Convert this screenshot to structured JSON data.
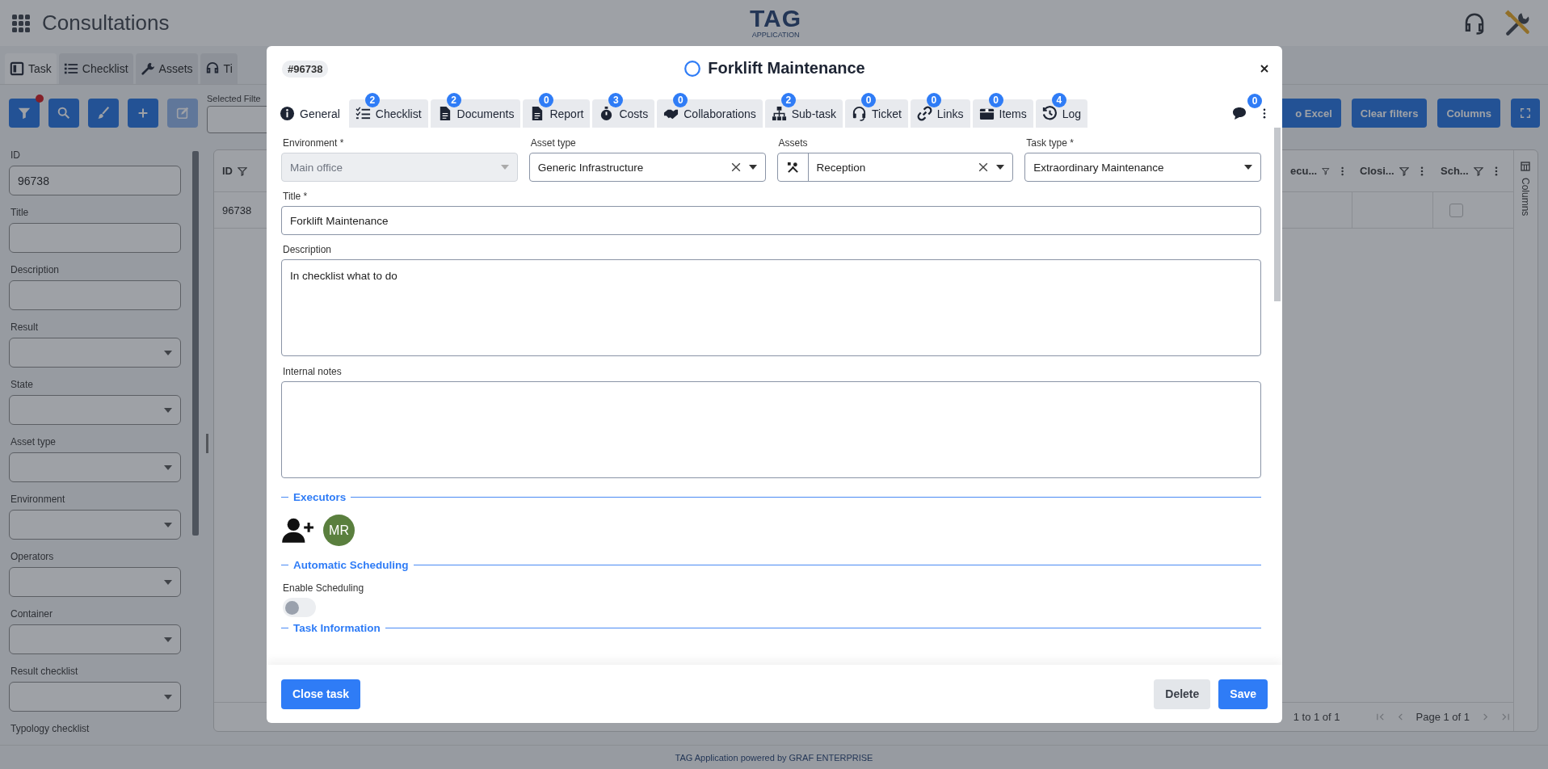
{
  "app": {
    "title": "Consultations",
    "logo": {
      "text": "TAG",
      "subtext": "APPLICATION"
    }
  },
  "page_tabs": [
    {
      "label": "Task",
      "selected": true
    },
    {
      "label": "Checklist",
      "selected": false
    },
    {
      "label": "Assets",
      "selected": false
    },
    {
      "label": "Ti",
      "selected": false
    }
  ],
  "toolbar": {
    "buttons": [
      {
        "kind": "filter",
        "disabled": false,
        "indicator": true
      },
      {
        "kind": "search",
        "disabled": false,
        "indicator": false
      },
      {
        "kind": "brush",
        "disabled": false,
        "indicator": false
      },
      {
        "kind": "add",
        "disabled": false,
        "indicator": false
      },
      {
        "kind": "edit",
        "disabled": true,
        "indicator": false
      }
    ],
    "selected_filters_label": "Selected Filte",
    "actions": [
      "o Excel",
      "Clear filters",
      "Columns"
    ]
  },
  "filters": [
    {
      "label": "ID",
      "kind": "text",
      "value": "96738"
    },
    {
      "label": "Title",
      "kind": "text"
    },
    {
      "label": "Description",
      "kind": "text"
    },
    {
      "label": "Result",
      "kind": "select"
    },
    {
      "label": "State",
      "kind": "select"
    },
    {
      "label": "Asset type",
      "kind": "select"
    },
    {
      "label": "Environment",
      "kind": "select"
    },
    {
      "label": "Operators",
      "kind": "select"
    },
    {
      "label": "Container",
      "kind": "select"
    },
    {
      "label": "Result checklist",
      "kind": "select"
    },
    {
      "label": "Typology checklist",
      "kind": "label"
    }
  ],
  "grid": {
    "columns": [
      "ID",
      "ecu...",
      "Closi...",
      "Sch..."
    ],
    "rows": [
      {
        "id": "96738",
        "scheduled": false
      }
    ],
    "side_panel": "Columns",
    "pagination": {
      "summary": "1 to 1 of 1",
      "page": "Page 1 of 1"
    }
  },
  "footer": "TAG Application powered by GRAF ENTERPRISE",
  "modal": {
    "badge": "#96738",
    "title": "Forklift Maintenance",
    "tabs": [
      {
        "label": "General",
        "selected": true
      },
      {
        "label": "Checklist",
        "count": "2",
        "selected": false
      },
      {
        "label": "Documents",
        "count": "2",
        "selected": false
      },
      {
        "label": "Report",
        "count": "0",
        "selected": false
      },
      {
        "label": "Costs",
        "count": "3",
        "selected": false
      },
      {
        "label": "Collaborations",
        "count": "0",
        "selected": false
      },
      {
        "label": "Sub-task",
        "count": "2",
        "selected": false
      },
      {
        "label": "Ticket",
        "count": "0",
        "selected": false
      },
      {
        "label": "Links",
        "count": "0",
        "selected": false
      },
      {
        "label": "Items",
        "count": "0",
        "selected": false
      },
      {
        "label": "Log",
        "count": "4",
        "selected": false
      }
    ],
    "comments_count": "0",
    "fields": [
      {
        "label": "Environment *",
        "value": "Main office",
        "disabled": true,
        "clearable": false,
        "prefix_icon": false
      },
      {
        "label": "Asset type",
        "value": "Generic Infrastructure",
        "disabled": false,
        "clearable": true,
        "prefix_icon": false
      },
      {
        "label": "Assets",
        "value": "Reception",
        "disabled": false,
        "clearable": true,
        "prefix_icon": true
      },
      {
        "label": "Task type *",
        "value": "Extraordinary Maintenance",
        "disabled": false,
        "clearable": false,
        "prefix_icon": false
      }
    ],
    "title_field": {
      "label": "Title *",
      "value": "Forklift Maintenance"
    },
    "description": {
      "label": "Description",
      "value": "In checklist what to do"
    },
    "internal_notes": {
      "label": "Internal notes"
    },
    "executors": {
      "heading": "Executors",
      "people": [
        {
          "initials": "MR"
        }
      ]
    },
    "scheduling": {
      "heading": "Automatic Scheduling",
      "toggle_label": "Enable Scheduling",
      "on": false
    },
    "next_section": "Task Information",
    "buttons": {
      "close": "Close task",
      "delete": "Delete",
      "save": "Save"
    }
  }
}
